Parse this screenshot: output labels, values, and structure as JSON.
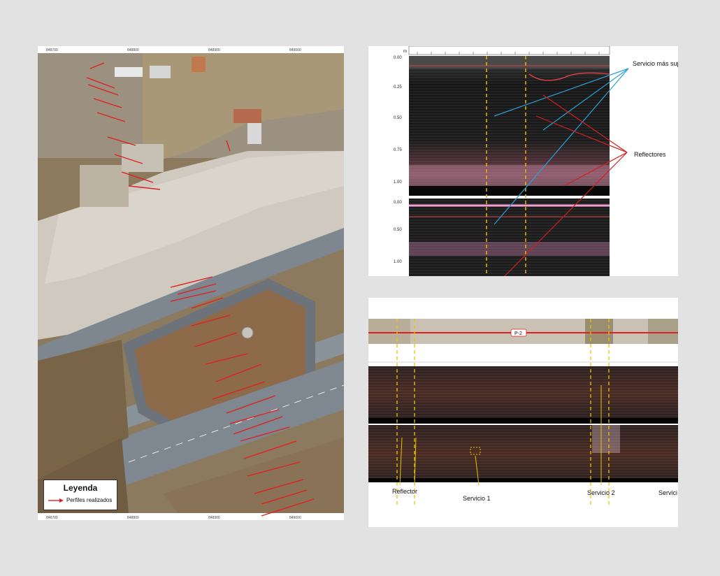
{
  "map": {
    "coords_top": [
      "848700",
      "848800",
      "848900",
      "849000"
    ],
    "coords_bottom": [
      "848700",
      "848800",
      "848900",
      "849000"
    ],
    "legend": {
      "title": "Leyenda",
      "entry": "Perfiles realizados"
    },
    "profile_color": "#e02020"
  },
  "gpr_top": {
    "depth_labels_upper": [
      "0.00",
      "0.25",
      "0.50",
      "0.75",
      "1.00"
    ],
    "depth_labels_lower": [
      "0.00",
      "0.50",
      "1.00"
    ],
    "unit": "m",
    "annotations": {
      "service_label": "Servicio más superficial",
      "reflectors_label": "Reflectores"
    }
  },
  "gpr_bottom": {
    "profile_tag": "P-2",
    "labels": {
      "reflector": "Reflector",
      "service1": "Servicio 1",
      "service2": "Servicio 2",
      "service3": "Servici"
    },
    "accent_yellow": "#e6c700"
  }
}
